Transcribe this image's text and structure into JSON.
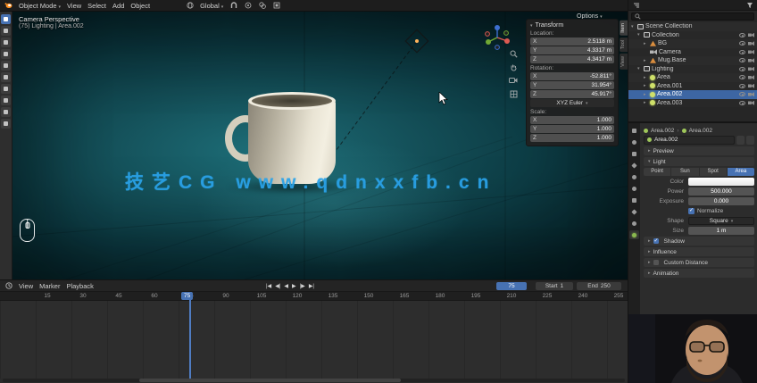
{
  "colors": {
    "accent_blue": "#4772b3",
    "selection_blue": "#3d66a3",
    "watermark_blue": "#2aa3ea",
    "viewport_teal": "#145059"
  },
  "topbar": {
    "mode": "Object Mode",
    "menus": [
      "View",
      "Select",
      "Add",
      "Object"
    ],
    "orientation": "Global",
    "options": "Options"
  },
  "viewport": {
    "view_name": "Camera Perspective",
    "active_info": "(75) Lighting | Area.002",
    "watermark": "技艺CG www.qdnxxfb.cn"
  },
  "npanel": {
    "title": "Transform",
    "tabs": [
      "Item",
      "Tool",
      "View"
    ],
    "groups": [
      {
        "label": "Location:",
        "rows": [
          {
            "axis": "X",
            "value": "2.5118 m"
          },
          {
            "axis": "Y",
            "value": "4.3317 m"
          },
          {
            "axis": "Z",
            "value": "4.3417 m"
          }
        ]
      },
      {
        "label": "Rotation:",
        "rows": [
          {
            "axis": "X",
            "value": "-52.811°"
          },
          {
            "axis": "Y",
            "value": "31.954°"
          },
          {
            "axis": "Z",
            "value": "45.917°"
          }
        ]
      },
      {
        "label": "Scale:",
        "rows": [
          {
            "axis": "X",
            "value": "1.000"
          },
          {
            "axis": "Y",
            "value": "1.000"
          },
          {
            "axis": "Z",
            "value": "1.000"
          }
        ]
      }
    ],
    "rotation_mode": "XYZ Euler"
  },
  "outliner": {
    "search_placeholder": "",
    "rows": [
      {
        "label": "Scene Collection"
      },
      {
        "label": "Collection"
      },
      {
        "label": "BG"
      },
      {
        "label": "Camera"
      },
      {
        "label": "Mug.Base"
      },
      {
        "label": "Lighting"
      },
      {
        "label": "Area"
      },
      {
        "label": "Area.001"
      },
      {
        "label": "Area.002"
      },
      {
        "label": "Area.003"
      }
    ]
  },
  "properties": {
    "breadcrumb_object": "Area.002",
    "breadcrumb_data": "Area.002",
    "datablock": "Area.002",
    "preview_section": "Preview",
    "light_section": "Light",
    "light_types": [
      "Point",
      "Sun",
      "Spot",
      "Area"
    ],
    "active_type": "Area",
    "color_label": "Color",
    "power_label": "Power",
    "power": "500.000",
    "exposure_label": "Exposure",
    "exposure": "0.000",
    "normalize_label": "Normalize",
    "shape_label": "Shape",
    "shape": "Square",
    "size_label": "Size",
    "size": "1 m",
    "sections": [
      "Shadow",
      "Influence",
      "Custom Distance",
      "Animation"
    ]
  },
  "timeline": {
    "menus": [
      "View",
      "Marker",
      "Playback"
    ],
    "controls": [
      "|◀",
      "◀|",
      "◀",
      "▶",
      "|▶",
      "▶|"
    ],
    "frame": "75",
    "playhead": "75",
    "start_label": "Start",
    "start": "1",
    "end_label": "End",
    "end": "250",
    "ruler": [
      "15",
      "30",
      "45",
      "60",
      "75",
      "90",
      "105",
      "120",
      "135",
      "150",
      "165",
      "180",
      "195",
      "210",
      "225",
      "240",
      "255"
    ]
  }
}
